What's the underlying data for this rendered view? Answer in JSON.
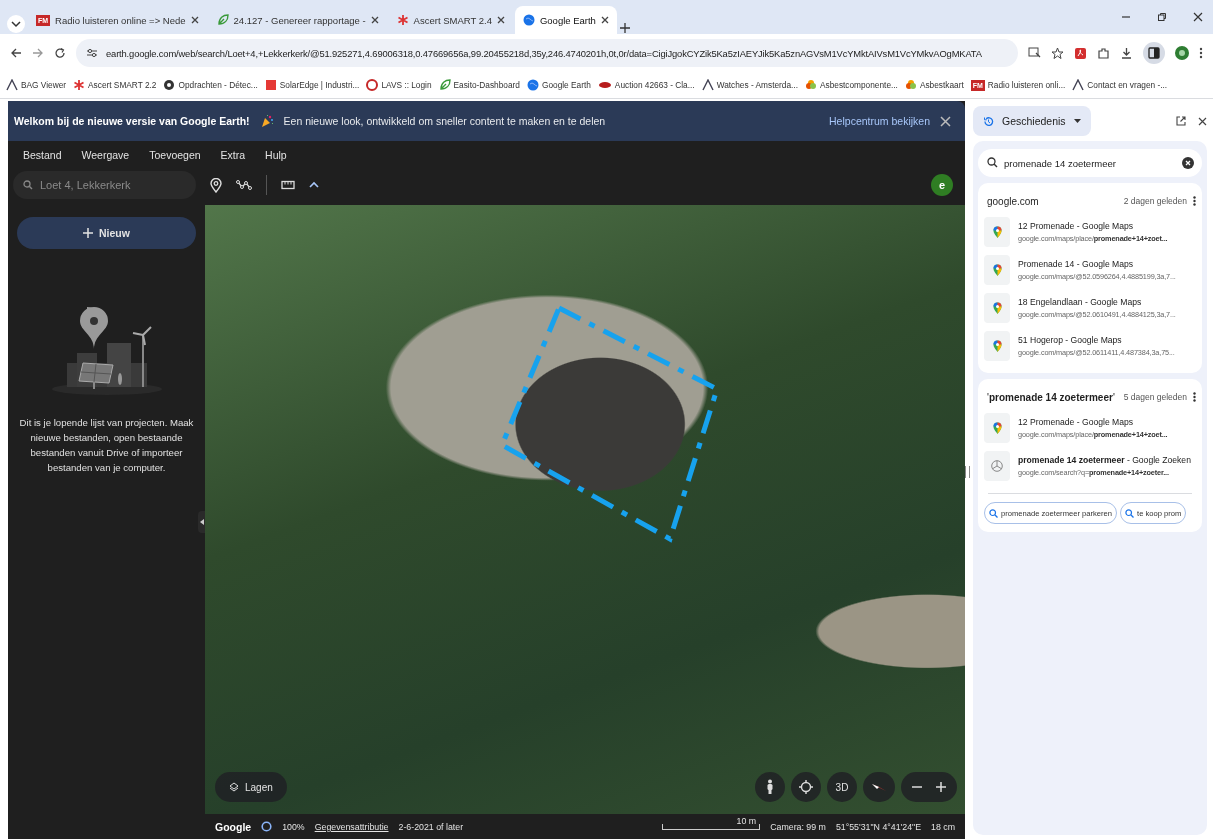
{
  "browser": {
    "tabs": [
      {
        "title": "Radio luisteren online => Nede",
        "selected": false,
        "favicon_text": "FM"
      },
      {
        "title": "24.127 - Genereer rapportage -",
        "selected": false
      },
      {
        "title": "Ascert SMART 2.4",
        "selected": false
      },
      {
        "title": "Google Earth",
        "selected": true
      }
    ],
    "url": "earth.google.com/web/search/Loet+4,+Lekkerkerk/@51.925271,4.69006318,0.47669656a,99.20455218d,35y,246.4740201h,0t,0r/data=CigiJgokCYZik5Ka5zIAEYJik5Ka5znAGVsM1VcYMktAIVsM1VcYMkvAOgMKATA",
    "bookmarks": [
      {
        "label": "BAG Viewer"
      },
      {
        "label": "Ascert SMART 2.2"
      },
      {
        "label": "Opdrachten - Détec..."
      },
      {
        "label": "SolarEdge | Industri..."
      },
      {
        "label": "LAVS :: Login"
      },
      {
        "label": "Easito-Dashboard"
      },
      {
        "label": "Google Earth"
      },
      {
        "label": "Auction 42663 - Cla..."
      },
      {
        "label": "Watches - Amsterda..."
      },
      {
        "label": "Asbestcomponente..."
      },
      {
        "label": "Asbestkaart"
      },
      {
        "label": "Radio luisteren onli...",
        "icon_text": "FM"
      },
      {
        "label": "Contact en vragen -..."
      }
    ]
  },
  "earth": {
    "banner": {
      "title": "Welkom bij de nieuwe versie van Google Earth!",
      "text": "Een nieuwe look, ontwikkeld om sneller content te maken en te delen",
      "link": "Helpcentrum bekijken"
    },
    "menu": [
      "Bestand",
      "Weergave",
      "Toevoegen",
      "Extra",
      "Hulp"
    ],
    "search": {
      "placeholder": "Loet 4, Lekkerkerk"
    },
    "avatar": "e",
    "new_button": "Nieuw",
    "empty_message": "Dit is je lopende lijst van projecten. Maak nieuwe bestanden, open bestaande bestanden vanuit Drive of importeer bestanden van je computer.",
    "map": {
      "layers_button": "Lagen",
      "view_button": "3D"
    },
    "status_bar": {
      "logo": "Google",
      "zoom": "100%",
      "attribution": "Gegevensattributie",
      "date": "2-6-2021 of later",
      "scale": "10 m",
      "camera": "Camera: 99 m",
      "coordinates": "51°55'31\"N 4°41'24\"E",
      "altitude": "18 cm"
    }
  },
  "history": {
    "title": "Geschiedenis",
    "search": {
      "value": "promenade 14 zoetermeer"
    },
    "groups": [
      {
        "heading": "google.com",
        "time": "2 dagen geleden",
        "items": [
          {
            "kind": "maps",
            "title": "12 Promenade - Google Maps",
            "url": "google.com/maps/place/**promenade+14+zoet...**"
          },
          {
            "kind": "maps",
            "title": "Promenade 14 - Google Maps",
            "url": "google.com/maps/@52.0596264,4.4885199,3a,7..."
          },
          {
            "kind": "maps",
            "title": "18 Engelandlaan - Google Maps",
            "url": "google.com/maps/@52.0610491,4.4884125,3a,7..."
          },
          {
            "kind": "maps",
            "title": "51 Hogerop - Google Maps",
            "url": "google.com/maps/@52.0611411,4.487384,3a,75..."
          }
        ]
      },
      {
        "heading": "'**promenade 14 zoetermeer**'",
        "time": "5 dagen geleden",
        "items": [
          {
            "kind": "maps",
            "title": "12 Promenade - Google Maps",
            "url": "google.com/maps/place/**promenade+14+zoet...**"
          },
          {
            "kind": "search",
            "title": "**promenade 14 zoetermeer** - Google Zoeken",
            "url": "google.com/search?q=**promenade+14+zoeter...**"
          }
        ]
      }
    ],
    "suggestions": [
      "promenade zoetermeer parkeren",
      "te koop prom"
    ]
  }
}
